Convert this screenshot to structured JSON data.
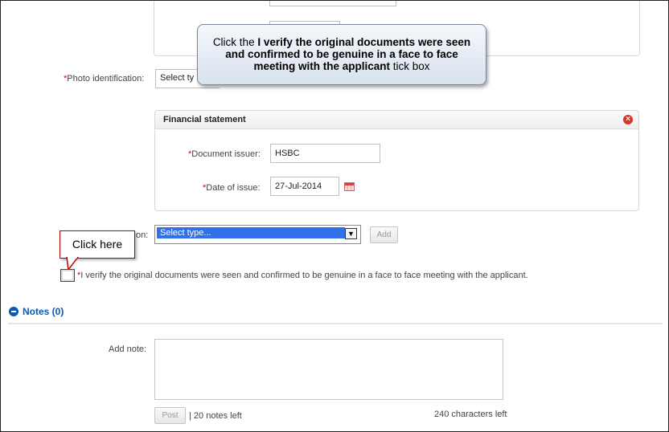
{
  "form": {
    "photo_id_label": "Photo identification:",
    "photo_id_select_partial": "Select ty",
    "fin_panel_title": "Financial statement",
    "doc_issuer_label": "Document issuer:",
    "doc_issuer_value": "HSBC",
    "date_issue_label": "Date of issue:",
    "date_issue_value": "27-Jul-2014",
    "other_label_partial": "on:",
    "select_type_value": "Select type...",
    "add_label": "Add",
    "verify_text": "I verify the original documents were seen and confirmed to be genuine in a face to face meeting with the applicant."
  },
  "notes": {
    "header": "Notes (0)",
    "add_note_label": "Add note:",
    "post_label": "Post",
    "notes_left": "| 20 notes left",
    "chars_left": "240 characters left"
  },
  "callouts": {
    "instruction_pre": "Click the ",
    "instruction_bold": "I verify the original documents were seen and confirmed to be genuine in a face to face meeting with the applicant",
    "instruction_post": " tick box",
    "click_here": "Click here"
  },
  "colors": {
    "accent": "#0b58b6",
    "required": "#dd0000",
    "select_highlight": "#3170e8",
    "callout_border": "#c00000"
  }
}
